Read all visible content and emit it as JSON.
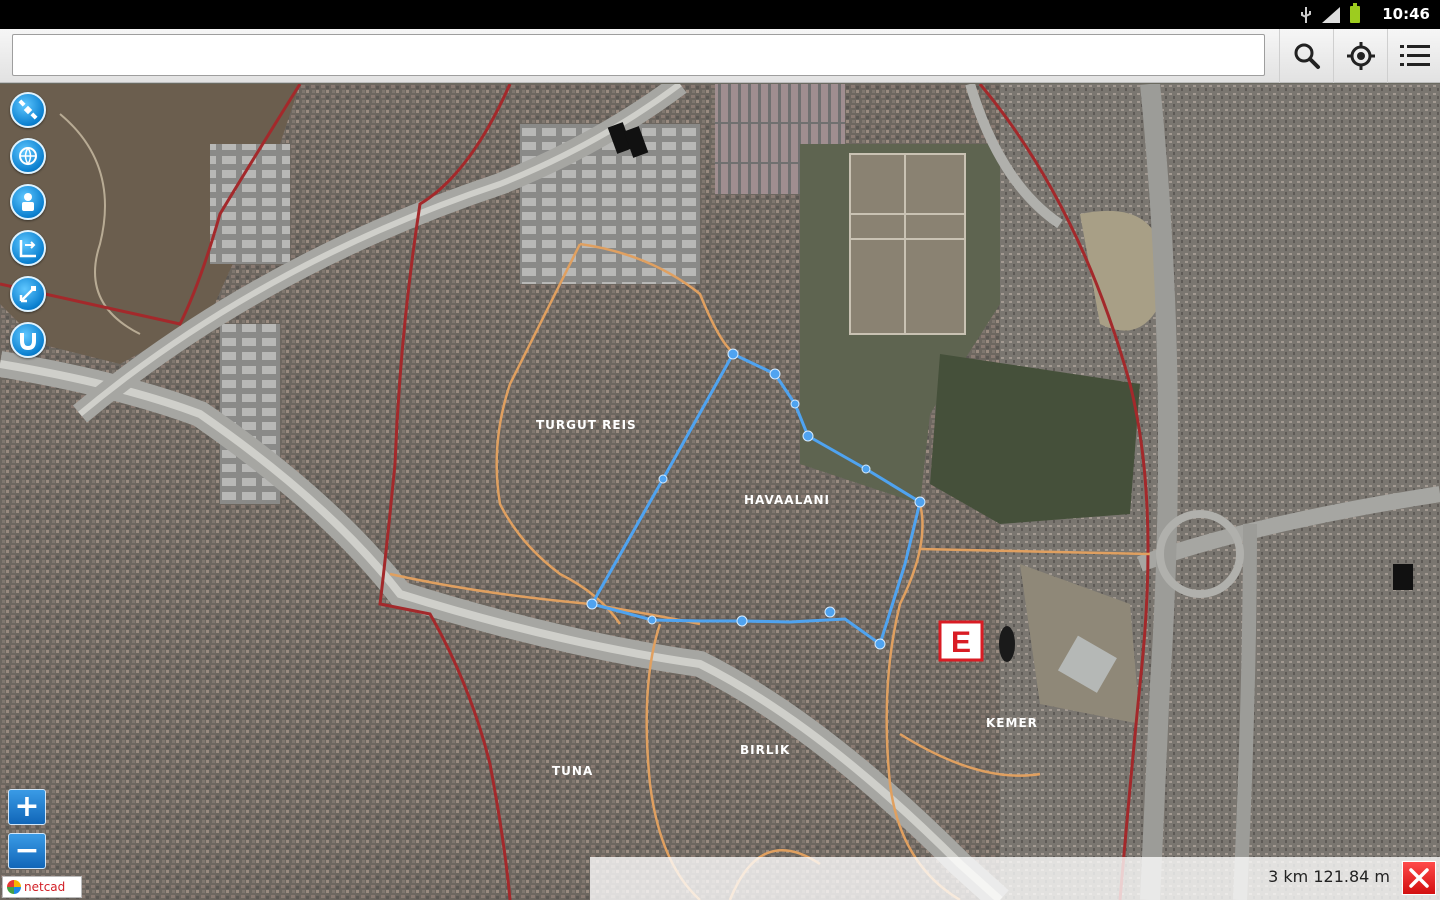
{
  "status_bar": {
    "time": "10:46"
  },
  "search": {
    "value": "",
    "placeholder": ""
  },
  "toolbar": {
    "search_icon": "search-icon",
    "locate_icon": "crosshair-icon",
    "menu_icon": "menu-icon"
  },
  "tools": [
    {
      "name": "satellite-icon"
    },
    {
      "name": "globe-layers-icon"
    },
    {
      "name": "info-pin-icon"
    },
    {
      "name": "measure-line-icon"
    },
    {
      "name": "measure-area-icon"
    },
    {
      "name": "magnet-icon"
    }
  ],
  "zoom": {
    "in_label": "+",
    "out_label": "−"
  },
  "logo": {
    "text": "netcad"
  },
  "map": {
    "labels": [
      "TURGUT REIS",
      "HAVAALANI",
      "KEMER",
      "BIRLIK",
      "TUNA"
    ],
    "marker": {
      "letter": "E",
      "color": "#d91c24"
    },
    "colors": {
      "district_border": "#a3292b",
      "street": "#e0a060",
      "route": "#4fa3f0",
      "highway": "#b9b9b9"
    }
  },
  "scale": {
    "text": "3 km 121.84 m"
  },
  "colors": {
    "accent": "#0a7fcf",
    "close": "#d20f0f"
  }
}
